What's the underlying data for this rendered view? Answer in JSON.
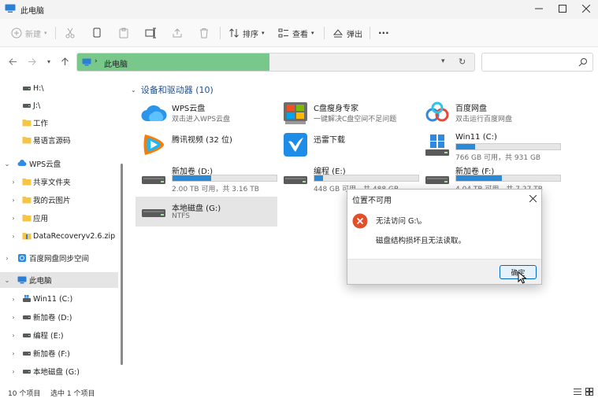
{
  "window": {
    "title": "此电脑",
    "minimize_icon": "minimize-icon",
    "maximize_icon": "maximize-icon",
    "close_icon": "close-icon"
  },
  "toolbar": {
    "new_label": "新建",
    "sort_label": "排序",
    "view_label": "查看",
    "eject_label": "弹出",
    "more_label": "···"
  },
  "address": {
    "crumb": "此电脑",
    "search_placeholder": ""
  },
  "sidebar": {
    "items": [
      {
        "label": "H:\\",
        "icon": "drive-icon"
      },
      {
        "label": "J:\\",
        "icon": "drive-icon"
      },
      {
        "label": "工作",
        "icon": "folder-icon"
      },
      {
        "label": "易语言源码",
        "icon": "folder-icon"
      },
      {
        "label": "WPS云盘",
        "icon": "cloud-icon"
      },
      {
        "label": "共享文件夹",
        "icon": "folder-icon"
      },
      {
        "label": "我的云图片",
        "icon": "folder-icon"
      },
      {
        "label": "应用",
        "icon": "folder-icon"
      },
      {
        "label": "DataRecoveryv2.6.zip",
        "icon": "zip-icon"
      },
      {
        "label": "百度网盘同步空间",
        "icon": "baidu-sync-icon"
      },
      {
        "label": "此电脑",
        "icon": "pc-icon"
      },
      {
        "label": "Win11 (C:)",
        "icon": "windows-drive-icon"
      },
      {
        "label": "新加卷 (D:)",
        "icon": "drive-icon"
      },
      {
        "label": "编程 (E:)",
        "icon": "drive-icon"
      },
      {
        "label": "新加卷 (F:)",
        "icon": "drive-icon"
      },
      {
        "label": "本地磁盘 (G:)",
        "icon": "drive-icon"
      }
    ]
  },
  "content": {
    "group_title": "设备和驱动器 (10)",
    "tiles": [
      {
        "name": "WPS云盘",
        "sub": "双击进入WPS云盘",
        "icon": "wps-cloud-icon"
      },
      {
        "name": "C盘瘦身专家",
        "sub": "一键解决C盘空间不足问题",
        "icon": "c-drive-cleaner-icon"
      },
      {
        "name": "百度网盘",
        "sub": "双击运行百度网盘",
        "icon": "baidu-netdisk-icon"
      },
      {
        "name": "腾讯视频 (32 位)",
        "sub": "",
        "icon": "tencent-video-icon"
      },
      {
        "name": "迅雷下载",
        "sub": "",
        "icon": "xunlei-icon"
      },
      {
        "name": "Win11 (C:)",
        "bar_sub": "766 GB 可用，共 931 GB",
        "fill": 0.18,
        "icon": "windows-drive-icon"
      },
      {
        "name": "新加卷 (D:)",
        "bar_sub": "2.00 TB 可用，共 3.16 TB",
        "fill": 0.37,
        "icon": "drive-icon"
      },
      {
        "name": "编程 (E:)",
        "bar_sub": "448 GB 可用，共 488 GB",
        "fill": 0.08,
        "icon": "drive-icon"
      },
      {
        "name": "新加卷 (F:)",
        "bar_sub": "4.04 TB 可用，共 7.27 TB",
        "fill": 0.44,
        "icon": "drive-icon"
      },
      {
        "name": "本地磁盘 (G:)",
        "sub": "NTFS",
        "icon": "drive-icon"
      }
    ]
  },
  "status": {
    "count": "10 个项目",
    "selected": "选中 1 个项目"
  },
  "dialog": {
    "title": "位置不可用",
    "message_1": "无法访问 G:\\。",
    "message_2": "磁盘结构损坏且无法读取。",
    "ok_label": "确定"
  },
  "colors": {
    "accent": "#0067c0",
    "address_highlight": "#77c88a",
    "progress": "#2a8ad8",
    "error": "#e2502b"
  }
}
